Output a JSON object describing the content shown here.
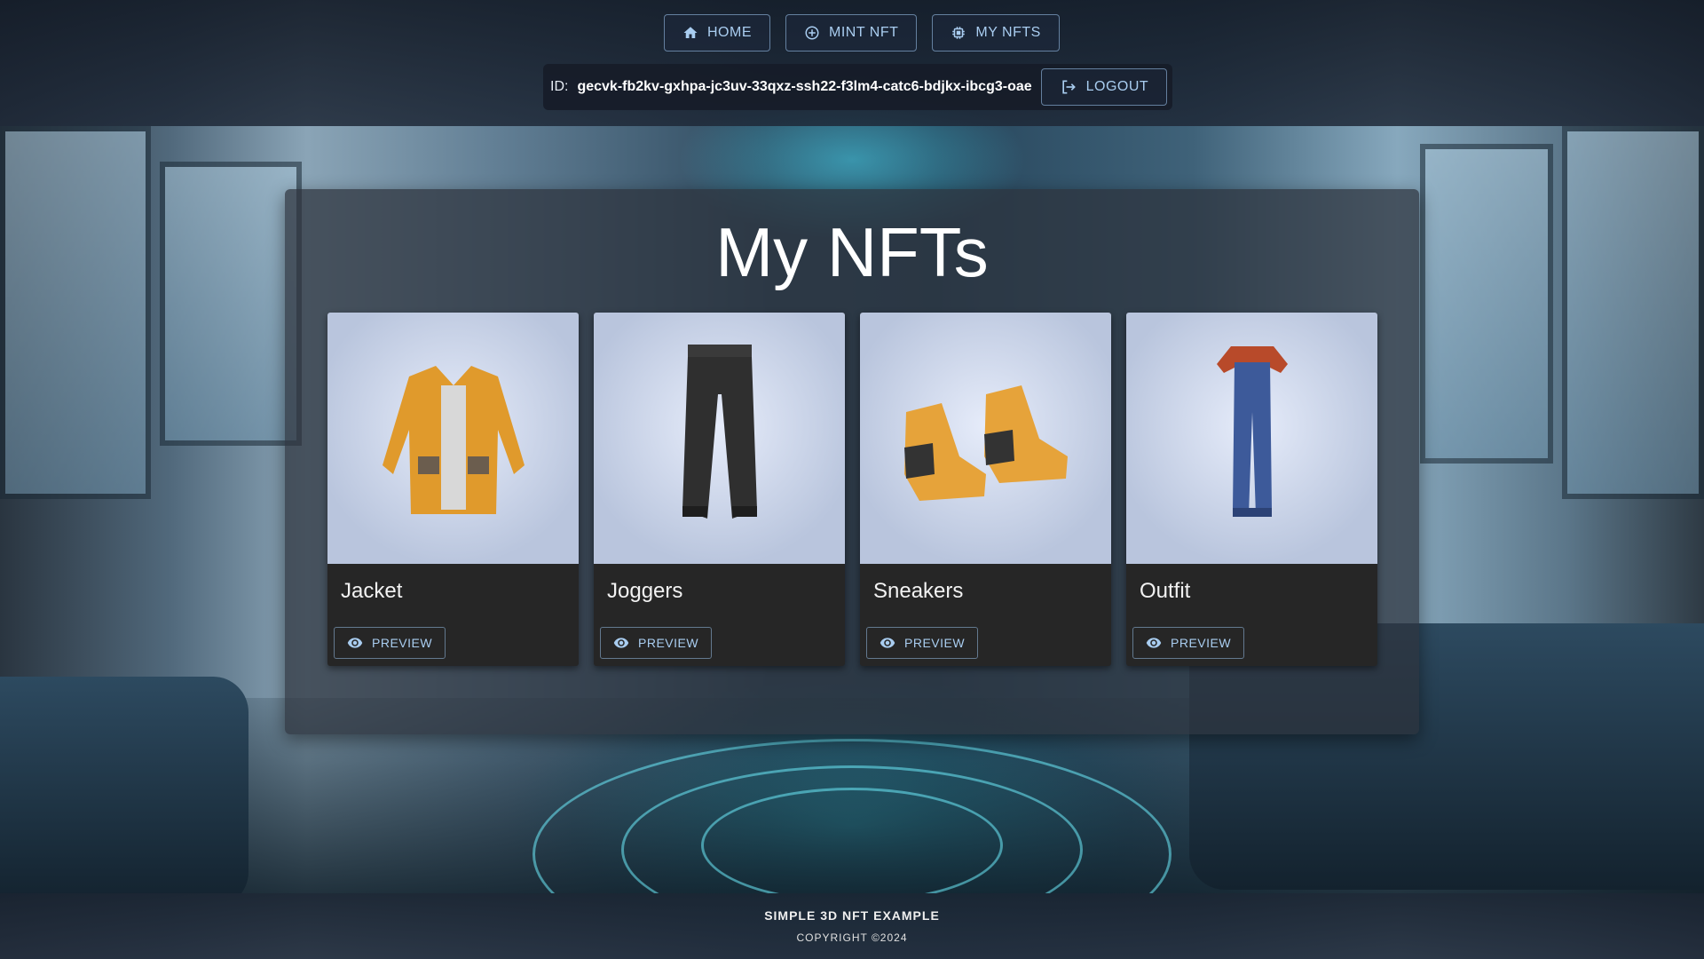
{
  "nav": {
    "home": {
      "label": "HOME",
      "icon": "home-icon"
    },
    "mint": {
      "label": "MINT NFT",
      "icon": "add-circle-icon"
    },
    "my_nfts": {
      "label": "MY NFTS",
      "icon": "chip-icon"
    }
  },
  "session": {
    "id_label": "ID:",
    "id_value": "gecvk-fb2kv-gxhpa-jc3uv-33qxz-ssh22-f3lm4-catc6-bdjkx-ibcg3-oae",
    "logout_label": "LOGOUT",
    "logout_icon": "logout-icon"
  },
  "page": {
    "title": "My NFTs"
  },
  "nfts": [
    {
      "name": "Jacket",
      "preview_label": "PREVIEW",
      "icon": "jacket-image"
    },
    {
      "name": "Joggers",
      "preview_label": "PREVIEW",
      "icon": "joggers-image"
    },
    {
      "name": "Sneakers",
      "preview_label": "PREVIEW",
      "icon": "sneakers-image"
    },
    {
      "name": "Outfit",
      "preview_label": "PREVIEW",
      "icon": "outfit-image"
    }
  ],
  "footer": {
    "title": "SIMPLE 3D NFT EXAMPLE",
    "copyright": "COPYRIGHT ©2024"
  },
  "colors": {
    "accent": "#a9cdf0",
    "card_bg": "#262626",
    "panel_bg": "#2d323c",
    "thumb_bg": "#c9d3e8"
  }
}
